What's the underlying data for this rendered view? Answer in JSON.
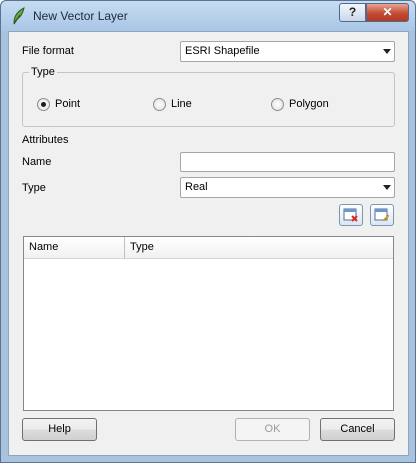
{
  "window": {
    "title": "New Vector Layer"
  },
  "titlebar_buttons": {
    "help": "?",
    "close": "✕"
  },
  "file_format": {
    "label": "File format",
    "value": "ESRI Shapefile"
  },
  "type_group": {
    "title": "Type",
    "options": [
      {
        "label": "Point",
        "selected": true
      },
      {
        "label": "Line",
        "selected": false
      },
      {
        "label": "Polygon",
        "selected": false
      }
    ]
  },
  "attributes": {
    "heading": "Attributes",
    "name_label": "Name",
    "name_value": "",
    "type_label": "Type",
    "type_value": "Real"
  },
  "attribute_table": {
    "columns": [
      "Name",
      "Type"
    ],
    "rows": []
  },
  "buttons": {
    "help": "Help",
    "ok": "OK",
    "cancel": "Cancel"
  },
  "colors": {
    "titlebar": "#a9c6e6",
    "dialog_bg": "#f0f0f0",
    "close": "#c34b33"
  },
  "icons": [
    "qgis-app-icon",
    "remove-attribute-icon",
    "add-attribute-icon",
    "chevron-down-icon"
  ]
}
